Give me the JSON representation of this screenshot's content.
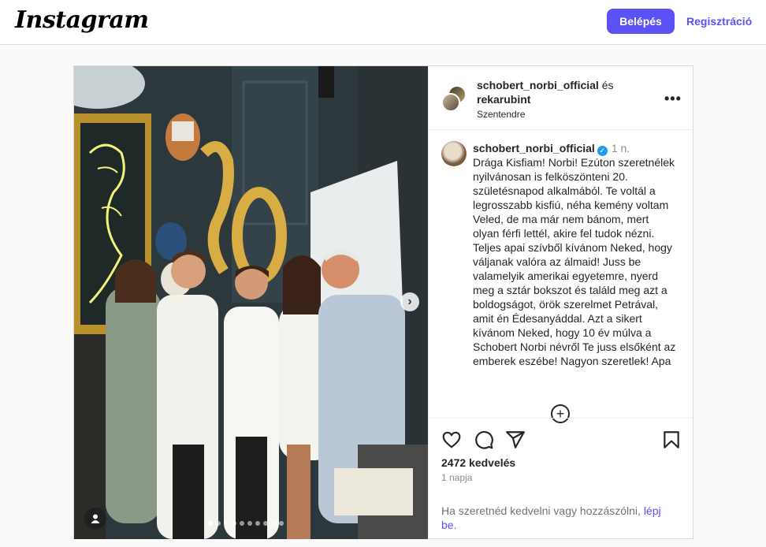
{
  "header": {
    "logo": "Instagram",
    "login_label": "Belépés",
    "signup_label": "Regisztráció"
  },
  "post": {
    "author_primary": "schobert_norbi_official",
    "conjunction": "és",
    "author_secondary": "rekarubint",
    "location": "Szentendre",
    "caption_author": "schobert_norbi_official",
    "caption_time": "1 n.",
    "caption_text": "Drága Kisfiam! Norbi! Ezúton szeretnélek nyilvánosan is felköszönteni 20. születésnapod alkalmából. Te voltál a legrosszabb kisfiú, néha kemény voltam Veled, de ma már nem bánom, mert olyan férfi lettél, akire fel tudok nézni. Teljes apai szívből kívánom Neked, hogy váljanak valóra az álmaid! Juss be valamelyik amerikai egyetemre, nyerd meg a sztár bokszot és találd meg azt a boldogságot, örök szerelmet Petrával, amit én Édesanyáddal. Azt a sikert kívánom Neked, hogy 10 év múlva a Schobert Norbi névről Te juss elsőként az emberek eszébe! Nagyon szeretlek! Apa",
    "likes": "2472 kedvelés",
    "posted_ago": "1 napja",
    "login_prompt_text": "Ha szeretnéd kedvelni vagy hozzászólni,",
    "login_prompt_link": "lépj be",
    "login_prompt_end": ".",
    "carousel_count": 10,
    "carousel_active": 0
  },
  "icons": {
    "like": "heart-icon",
    "comment": "comment-icon",
    "share": "share-icon",
    "save": "bookmark-icon",
    "more": "more-options-icon",
    "next": "chevron-right-icon",
    "tags": "user-tag-icon",
    "load_more": "plus-circle-icon",
    "verified": "verified-badge-icon"
  },
  "colors": {
    "accent": "#5b51f5",
    "verified": "#1d9bf0"
  }
}
